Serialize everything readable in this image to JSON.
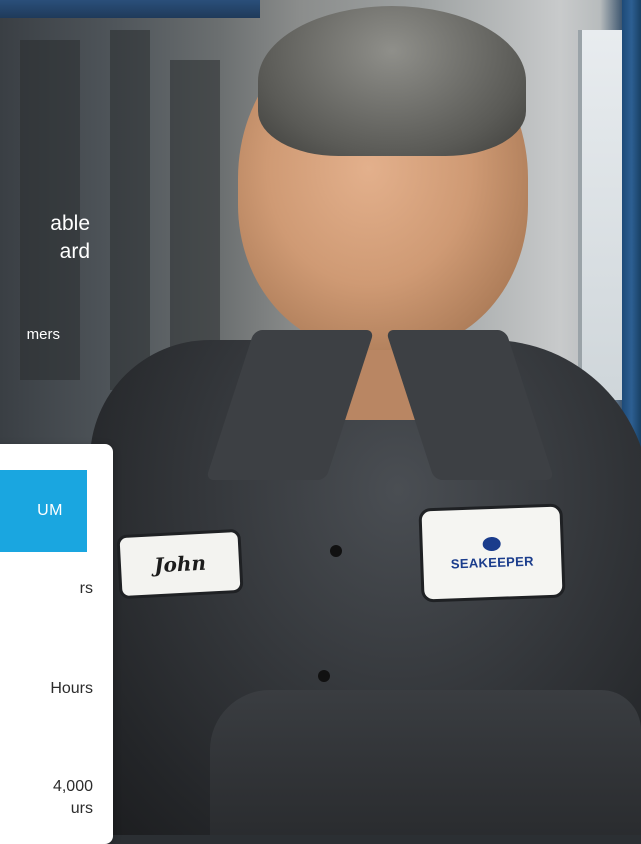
{
  "hero": {
    "line1": "able",
    "line2": "ard",
    "subtext": "mers"
  },
  "plan_card": {
    "tab_label": "UM",
    "rows": [
      "rs",
      "Hours",
      "4,000",
      "urs"
    ]
  },
  "photo": {
    "name_patch": "John",
    "logo_patch": "SEAKEEPER"
  },
  "colors": {
    "accent": "#1aa6e0",
    "card_bg": "#ffffff",
    "text_dark": "#2c2c2c"
  }
}
